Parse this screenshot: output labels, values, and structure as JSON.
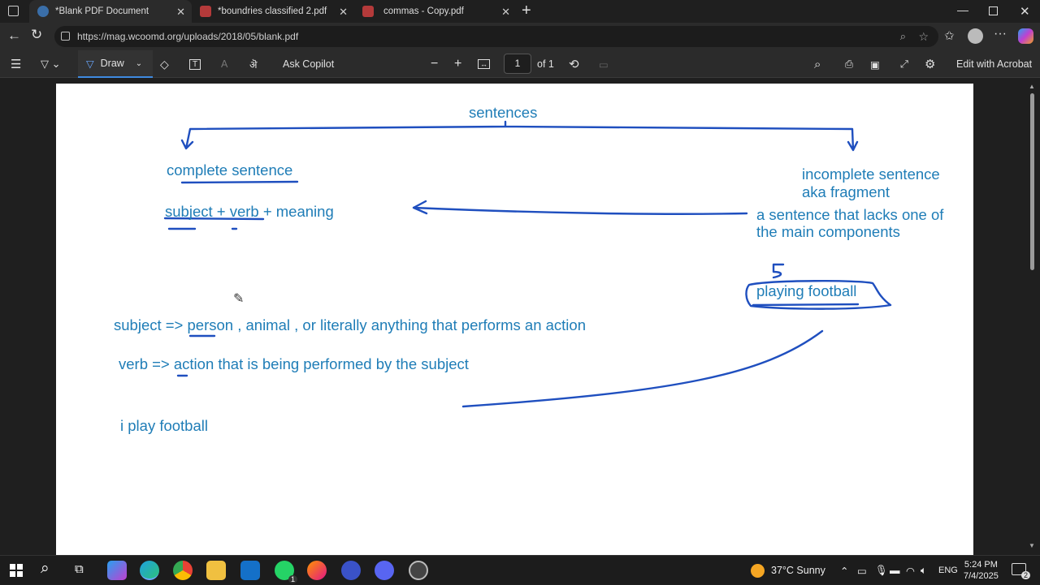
{
  "tabs": [
    {
      "label": "*Blank PDF Document",
      "active": true
    },
    {
      "label": "*boundries classified 2.pdf",
      "active": false
    },
    {
      "label": "commas - Copy.pdf",
      "active": false
    }
  ],
  "address": {
    "url": "https://mag.wcoomd.org/uploads/2018/05/blank.pdf"
  },
  "toolbar": {
    "draw_label": "Draw",
    "ask_copilot": "Ask Copilot",
    "page_number": "1",
    "page_of": "of 1",
    "edit_acrobat": "Edit with Acrobat"
  },
  "document": {
    "sentences": "sentences",
    "complete_sentence": "complete sentence",
    "subject_verb_meaning": "subject + verb + meaning",
    "incomplete_line1": "incomplete sentence",
    "incomplete_line2": "aka fragment",
    "lacks_line1": "a sentence that lacks one of",
    "lacks_line2": "the main components",
    "playing_football": "playing football",
    "subject_def": "subject => person , animal , or literally anything that performs an action",
    "verb_def": "verb => action that is being performed by the subject",
    "example": "i play football"
  },
  "colors": {
    "ink_text": "#1f7db7",
    "ink_pen": "#1f4fbf"
  },
  "taskbar": {
    "weather": "37°C  Sunny",
    "lang": "ENG",
    "time": "5:24 PM",
    "date": "7/4/2025",
    "notifications": "2",
    "whatsapp_badge": "1"
  }
}
